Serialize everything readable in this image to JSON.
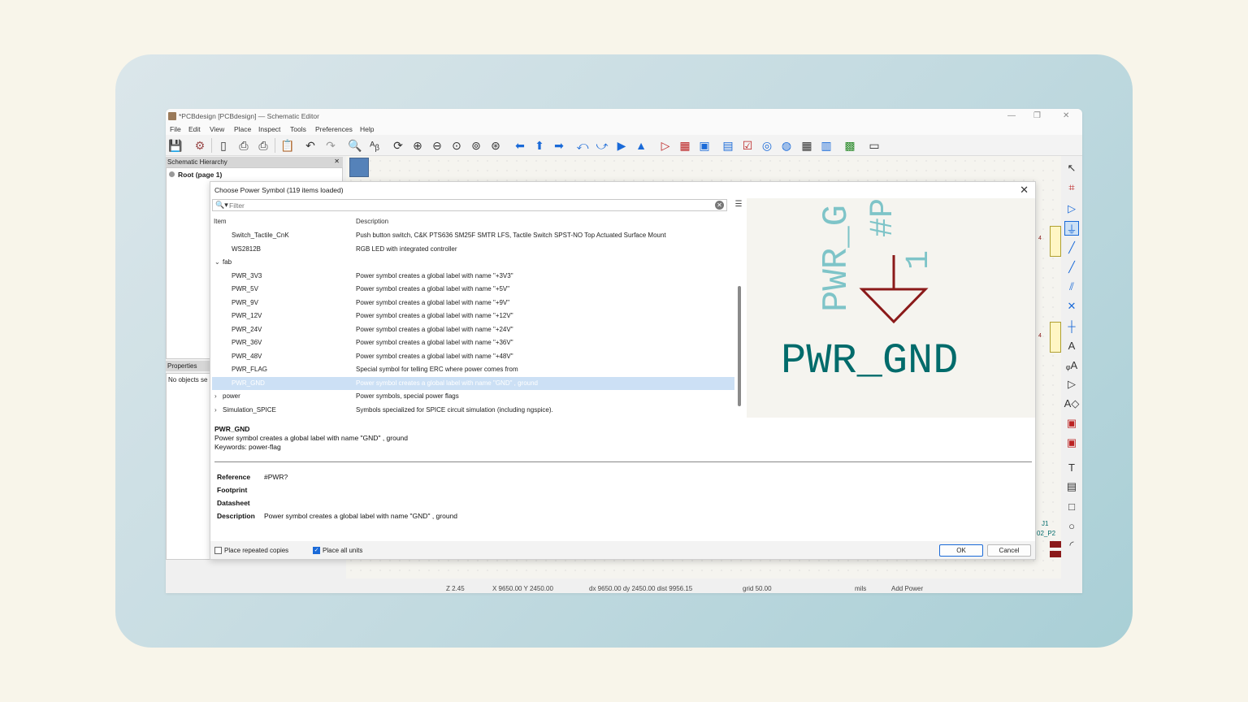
{
  "window": {
    "title": "*PCBdesign [PCBdesign] — Schematic Editor",
    "controls": [
      "—",
      "❐",
      "✕"
    ]
  },
  "menu": [
    "File",
    "Edit",
    "View",
    "Place",
    "Inspect",
    "Tools",
    "Preferences",
    "Help"
  ],
  "hierarchy": {
    "title": "Schematic Hierarchy",
    "root": "Root (page 1)"
  },
  "properties": {
    "title": "Properties",
    "empty": "No objects se"
  },
  "canvas_labels": {
    "ref_label": "J1",
    "net_label": "02_P2",
    "pin_a": "4",
    "pin_b": "4"
  },
  "dialog": {
    "title": "Choose Power Symbol (119 items loaded)",
    "filter_placeholder": "Filter",
    "columns": {
      "item": "Item",
      "description": "Description"
    },
    "rows": [
      {
        "name": "Switch_Tactile_CnK",
        "desc": "Push button switch, C&K PTS636 SM25F SMTR LFS, Tactile Switch SPST-NO Top Actuated Surface Mount",
        "level": 1,
        "expander": "",
        "selected": false
      },
      {
        "name": "WS2812B",
        "desc": "RGB LED with integrated controller",
        "level": 1,
        "expander": "",
        "selected": false
      },
      {
        "name": "fab",
        "desc": "",
        "level": 0,
        "expander": "⌄",
        "selected": false
      },
      {
        "name": "PWR_3V3",
        "desc": "Power symbol creates a global label with name \"+3V3\"",
        "level": 1,
        "expander": "",
        "selected": false
      },
      {
        "name": "PWR_5V",
        "desc": "Power symbol creates a global label with name \"+5V\"",
        "level": 1,
        "expander": "",
        "selected": false
      },
      {
        "name": "PWR_9V",
        "desc": "Power symbol creates a global label with name \"+9V\"",
        "level": 1,
        "expander": "",
        "selected": false
      },
      {
        "name": "PWR_12V",
        "desc": "Power symbol creates a global label with name \"+12V\"",
        "level": 1,
        "expander": "",
        "selected": false
      },
      {
        "name": "PWR_24V",
        "desc": "Power symbol creates a global label with name \"+24V\"",
        "level": 1,
        "expander": "",
        "selected": false
      },
      {
        "name": "PWR_36V",
        "desc": "Power symbol creates a global label with name \"+36V\"",
        "level": 1,
        "expander": "",
        "selected": false
      },
      {
        "name": "PWR_48V",
        "desc": "Power symbol creates a global label with name \"+48V\"",
        "level": 1,
        "expander": "",
        "selected": false
      },
      {
        "name": "PWR_FLAG",
        "desc": "Special symbol for telling ERC where power comes from",
        "level": 1,
        "expander": "",
        "selected": false
      },
      {
        "name": "PWR_GND",
        "desc": "Power symbol creates a global label with name \"GND\" , ground",
        "level": 1,
        "expander": "",
        "selected": true
      },
      {
        "name": "power",
        "desc": "Power symbols, special power flags",
        "level": 0,
        "expander": "›",
        "selected": false
      },
      {
        "name": "Simulation_SPICE",
        "desc": "Symbols specialized for SPICE circuit simulation (including ngspice).",
        "level": 0,
        "expander": "›",
        "selected": false
      }
    ],
    "preview": {
      "value_text": "PWR_GND",
      "ref_text": "#PWR",
      "rotated_text": "PWR_G",
      "pin_text": "1",
      "symbol_color": "#8b1a1a",
      "text_color": "#006b6b",
      "ghost_color": "#7ec4c8"
    },
    "details": {
      "name": "PWR_GND",
      "desc": "Power symbol creates a global label with name \"GND\" , ground",
      "keywords": "Keywords: power-flag",
      "fields": [
        {
          "label": "Reference",
          "value": "#PWR?"
        },
        {
          "label": "Footprint",
          "value": ""
        },
        {
          "label": "Datasheet",
          "value": ""
        },
        {
          "label": "Description",
          "value": "Power symbol creates a global label with name \"GND\" , ground"
        }
      ]
    },
    "footer": {
      "place_repeated": "Place repeated copies",
      "place_repeated_checked": false,
      "place_all_units": "Place all units",
      "place_all_units_checked": true,
      "ok": "OK",
      "cancel": "Cancel"
    }
  },
  "status": {
    "zoom": "Z 2.45",
    "xy": "X 9650.00  Y 2450.00",
    "delta": "dx 9650.00  dy 2450.00  dist 9956.15",
    "grid": "grid 50.00",
    "units": "mils",
    "mode": "Add Power"
  },
  "colors": {
    "accent": "#1a6ad8",
    "selection": "#cce0f5"
  }
}
